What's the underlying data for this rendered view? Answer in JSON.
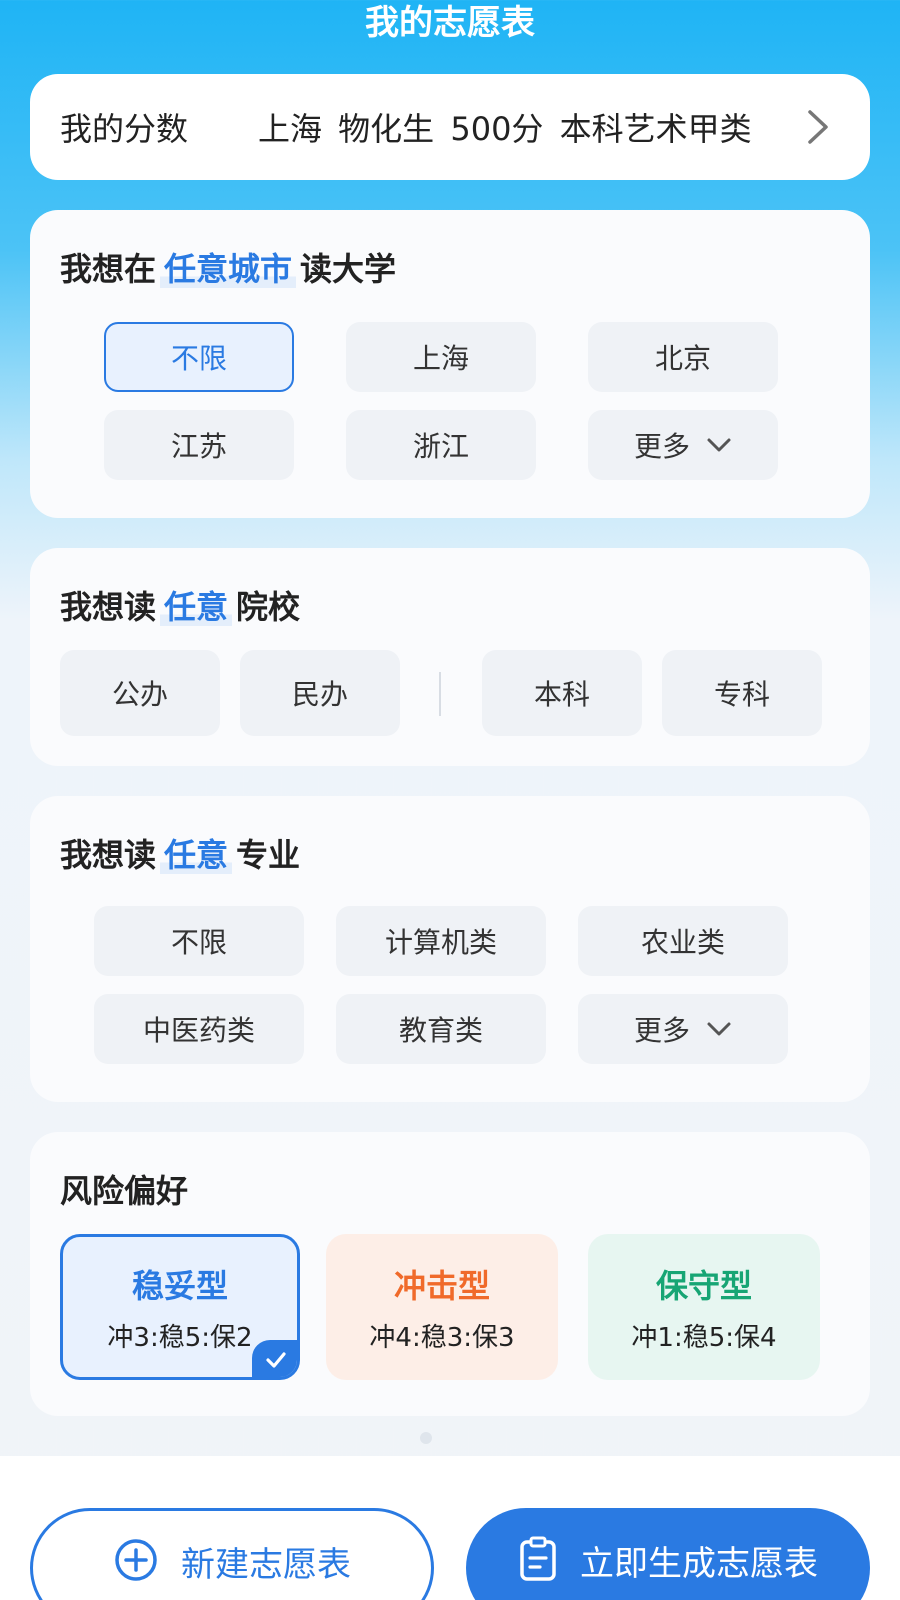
{
  "header": {
    "title": "我的志愿表"
  },
  "score": {
    "label": "我的分数",
    "value": "上海 物化生 500分 本科艺术甲类"
  },
  "city": {
    "prefix": "我想在",
    "highlight": "任意城市",
    "suffix": "读大学",
    "options": [
      "不限",
      "上海",
      "北京",
      "江苏",
      "浙江",
      "更多"
    ]
  },
  "school": {
    "prefix": "我想读",
    "highlight": "任意",
    "suffix": "院校",
    "options": [
      "公办",
      "民办",
      "本科",
      "专科"
    ]
  },
  "major": {
    "prefix": "我想读",
    "highlight": "任意",
    "suffix": "专业",
    "options": [
      "不限",
      "计算机类",
      "农业类",
      "中医药类",
      "教育类",
      "更多"
    ]
  },
  "risk": {
    "title": "风险偏好",
    "options": [
      {
        "name": "稳妥型",
        "ratio": "冲3:稳5:保2"
      },
      {
        "name": "冲击型",
        "ratio": "冲4:稳3:保3"
      },
      {
        "name": "保守型",
        "ratio": "冲1:稳5:保4"
      }
    ]
  },
  "actions": {
    "new_label": "新建志愿表",
    "generate_label": "立即生成志愿表"
  }
}
